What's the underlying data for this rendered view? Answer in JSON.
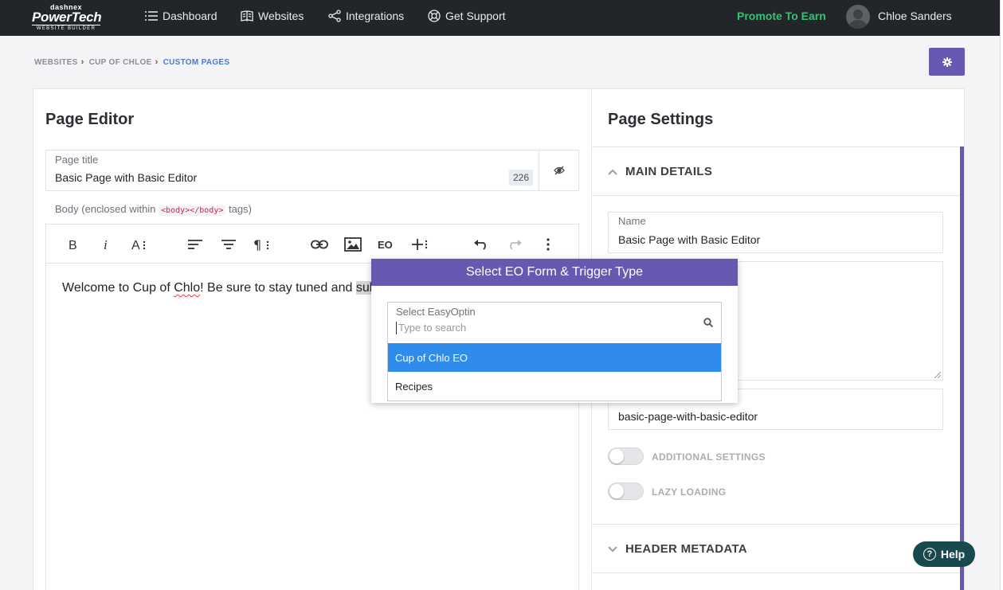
{
  "logo": {
    "line1": "dashnex",
    "line2": "PowerTech",
    "line3": "WEBSITE BUILDER"
  },
  "nav": {
    "dashboard": "Dashboard",
    "websites": "Websites",
    "integrations": "Integrations",
    "support": "Get Support",
    "promote": "Promote To Earn",
    "user": "Chloe Sanders"
  },
  "breadcrumb": {
    "websites": "WEBSITES",
    "site": "CUP OF CHLOE",
    "current": "CUSTOM PAGES"
  },
  "editor": {
    "title": "Page Editor",
    "page_title_label": "Page title",
    "page_title_value": "Basic Page with Basic Editor",
    "char_count": "226",
    "body_label_pre": "Body (enclosed within",
    "body_code": "<body></body>",
    "body_label_post": "tags)",
    "content_pre": "Welcome to Cup of ",
    "content_misspelled": "Chlo",
    "content_mid": "! Be sure to stay tuned and ",
    "content_selected": "sub"
  },
  "popup": {
    "title": "Select EO Form & Trigger Type",
    "select_label": "Select EasyOptin",
    "search_placeholder": "Type to search",
    "options": [
      "Cup of Chlo EO",
      "Recipes"
    ]
  },
  "settings": {
    "title": "Page Settings",
    "main_details": "MAIN DETAILS",
    "name_label": "Name",
    "name_value": "Basic Page with Basic Editor",
    "slug_value": "basic-page-with-basic-editor",
    "additional_settings": "ADDITIONAL SETTINGS",
    "lazy_loading": "LAZY LOADING",
    "header_metadata": "HEADER METADATA"
  },
  "help": "Help",
  "colors": {
    "accent": "#6759b2",
    "nav_bg": "#22252a",
    "promote": "#38c172",
    "option_highlight": "#2f8ceb",
    "help_bg": "#17494d"
  }
}
